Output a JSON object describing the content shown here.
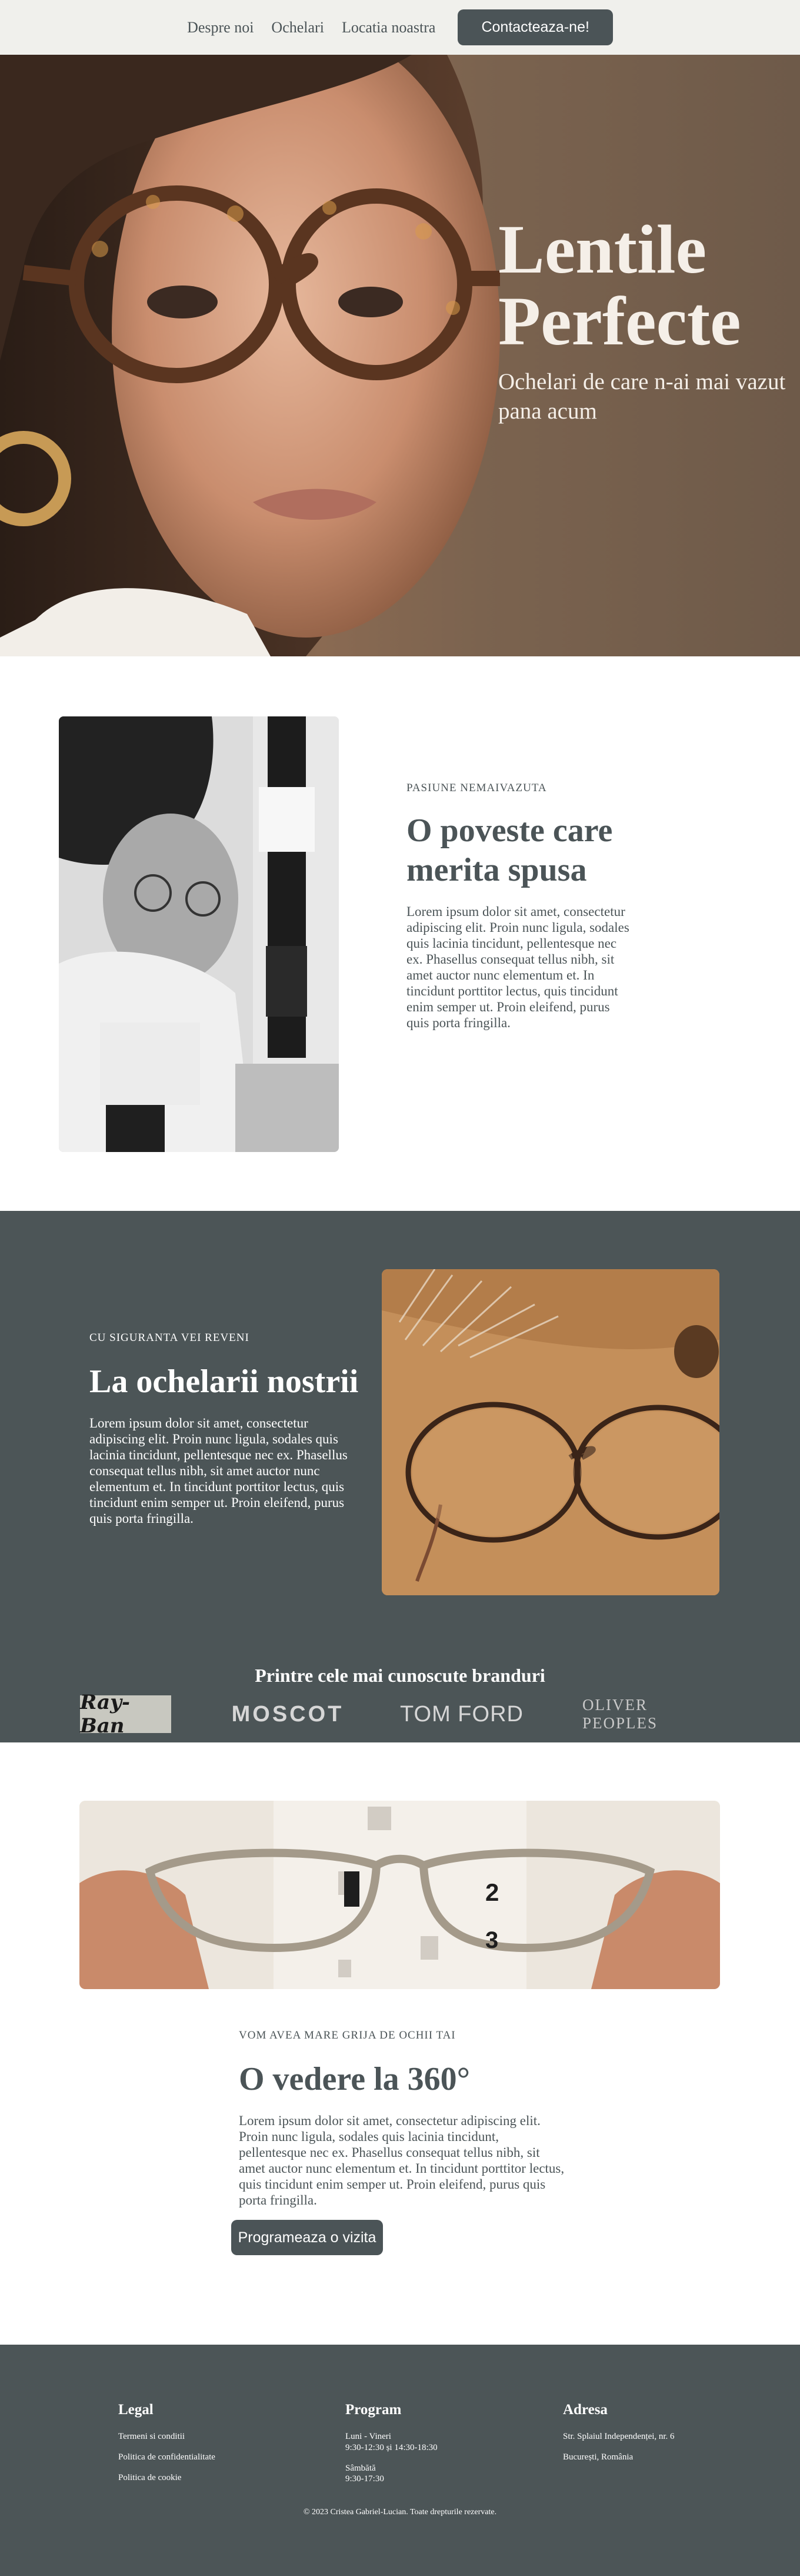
{
  "nav": {
    "items": [
      "Despre noi",
      "Ochelari",
      "Locatia noastra"
    ],
    "cta": "Contacteaza-ne!"
  },
  "hero": {
    "title_line1": "Lentile",
    "title_line2": "Perfecte",
    "subtitle": "Ochelari de care n-ai mai vazut pana acum"
  },
  "story": {
    "kicker": "PASIUNE NEMAIVAZUTA",
    "title": "O poveste care merita spusa",
    "body": "Lorem ipsum dolor sit amet, consectetur adipiscing elit. Proin nunc ligula, sodales quis lacinia tincidunt, pellentesque nec ex. Phasellus consequat tellus nibh, sit amet auctor nunc elementum et. In tincidunt porttitor lectus, quis tincidunt enim semper ut. Proin eleifend, purus quis porta fringilla."
  },
  "glasses": {
    "kicker": "CU SIGURANTA VEI REVENI",
    "title": "La ochelarii nostrii",
    "body": "Lorem ipsum dolor sit amet, consectetur adipiscing elit. Proin nunc ligula, sodales quis lacinia tincidunt, pellentesque nec ex. Phasellus consequat tellus nibh, sit amet auctor nunc elementum et. In tincidunt porttitor lectus, quis tincidunt enim semper ut. Proin eleifend, purus quis porta fringilla."
  },
  "brands": {
    "title": "Printre cele mai cunoscute branduri",
    "items": [
      "Ray-Ban",
      "MOSCOT",
      "TOM FORD",
      "OLIVER PEOPLES"
    ]
  },
  "vision": {
    "kicker": "VOM AVEA MARE GRIJA DE OCHII TAI",
    "title": "O vedere la 360°",
    "body": "Lorem ipsum dolor sit amet, consectetur adipiscing elit. Proin nunc ligula, sodales quis lacinia tincidunt, pellentesque nec ex. Phasellus consequat tellus nibh, sit amet auctor nunc elementum et. In tincidunt porttitor lectus, quis tincidunt enim semper ut. Proin eleifend, purus quis porta fringilla.",
    "button": "Programeaza o vizita"
  },
  "footer": {
    "legal": {
      "title": "Legal",
      "links": [
        "Termeni si conditii",
        "Politica de confidentialitate",
        "Politica de cookie"
      ]
    },
    "program": {
      "title": "Program",
      "weekdays_label": "Luni - Vineri",
      "weekdays_hours": "9:30-12:30 și 14:30-18:30",
      "saturday_label": "Sâmbătă",
      "saturday_hours": "9:30-17:30"
    },
    "address": {
      "title": "Adresa",
      "street": "Str. Splaiul Independenței, nr. 6",
      "city": "București, România"
    },
    "copyright": "© 2023 Cristea Gabriel-Lucian. Toate drepturile rezervate."
  },
  "colors": {
    "primary": "#4b5457",
    "nav_bg": "#f0f0ec",
    "white": "#ffffff"
  }
}
